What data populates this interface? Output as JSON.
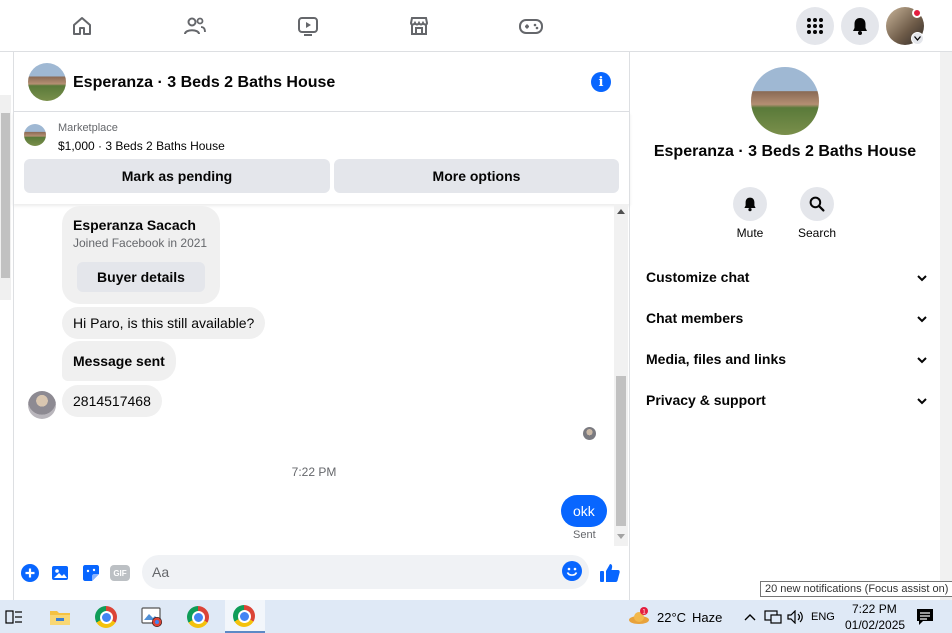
{
  "chat": {
    "title": "Esperanza · 3 Beds 2 Baths House"
  },
  "marketplace": {
    "label": "Marketplace",
    "listing": "$1,000 · 3 Beds 2 Baths House",
    "mark_pending": "Mark as pending",
    "more_options": "More options"
  },
  "buyer_card": {
    "name": "Esperanza Sacach",
    "joined": "Joined Facebook in 2021",
    "button": "Buyer details"
  },
  "messages": {
    "m1": "Hi Paro, is this still available?",
    "m2": "Message sent",
    "m3": "2814517468",
    "timestamp": "7:22 PM",
    "mine": "okk",
    "status": "Sent"
  },
  "composer": {
    "placeholder": "Aa",
    "gif": "GIF"
  },
  "panel": {
    "name": "Esperanza · 3 Beds 2 Baths House",
    "mute": "Mute",
    "search": "Search",
    "rows": [
      "Customize chat",
      "Chat members",
      "Media, files and links",
      "Privacy & support"
    ]
  },
  "tooltip": "20 new notifications (Focus assist on)",
  "taskbar": {
    "weather_temp": "22°C",
    "weather_desc": "Haze",
    "lang": "ENG",
    "time": "7:22 PM",
    "date": "01/02/2025"
  },
  "colors": {
    "accent": "#0866ff",
    "bubble": "#f0f0f0",
    "button_bg": "#e4e6eb"
  }
}
